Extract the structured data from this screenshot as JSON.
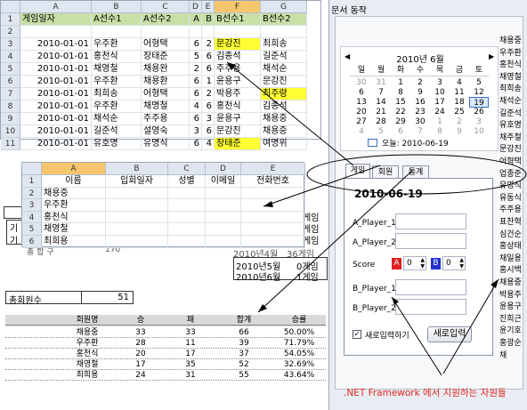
{
  "top_sheet": {
    "columns": [
      "A",
      "B",
      "C",
      "D",
      "E",
      "F",
      "G"
    ],
    "row_numbers": [
      "1",
      "2",
      "3",
      "4",
      "5",
      "6",
      "7",
      "8",
      "9",
      "10",
      "11"
    ],
    "header": [
      "게임일자",
      "A선수1",
      "A선수2",
      "A",
      "B",
      "B선수1",
      "B선수2"
    ],
    "rows": [
      [
        "",
        "",
        "",
        "",
        "",
        "",
        ""
      ],
      [
        "2010-01-01",
        "우주환",
        "어형택",
        "6",
        "2",
        "문강진",
        "최희송"
      ],
      [
        "2010-01-01",
        "홍천식",
        "장태준",
        "5",
        "6",
        "김종석",
        "길준석"
      ],
      [
        "2010-01-01",
        "채영철",
        "채용완",
        "2",
        "6",
        "주주용",
        "채석순"
      ],
      [
        "2010-01-01",
        "우주환",
        "채용환",
        "6",
        "1",
        "윤용구",
        "문강진"
      ],
      [
        "2010-01-01",
        "최희송",
        "어형택",
        "6",
        "2",
        "박용주",
        "최주령"
      ],
      [
        "2010-01-01",
        "우주환",
        "채명철",
        "4",
        "6",
        "홍천식",
        "김종석"
      ],
      [
        "2010-01-01",
        "채석순",
        "주주용",
        "6",
        "3",
        "윤용구",
        "채용중"
      ],
      [
        "2010-01-01",
        "길준석",
        "설영숙",
        "3",
        "6",
        "문강진",
        "채용중"
      ],
      [
        "2010-01-01",
        "유호명",
        "유명식",
        "6",
        "4",
        "장태준",
        "여명위"
      ]
    ]
  },
  "mid_sheet": {
    "columns": [
      "A",
      "B",
      "C",
      "D",
      "E"
    ],
    "row_numbers": [
      "1",
      "2",
      "3",
      "4",
      "5",
      "6"
    ],
    "header": [
      "이름",
      "입회일자",
      "성별",
      "이메일",
      "전화번호"
    ],
    "names": [
      "채용중",
      "우주환",
      "홍천식",
      "채영철",
      "최희용"
    ]
  },
  "back_fragments": {
    "left_labels": [
      "기",
      "기"
    ],
    "right_labels": [
      "게임",
      "게임",
      "게임",
      "게임"
    ],
    "total_row_left": "총 합 구",
    "total_row_num": "170",
    "partial_row": "2010년4월",
    "partial_count": "36게임",
    "month_rows": [
      {
        "month": "2010년5월",
        "count": "0게임"
      },
      {
        "month": "2010년6월",
        "count": "1게임"
      }
    ]
  },
  "member_total": {
    "label": "총회원수",
    "value": "51"
  },
  "stats_table": {
    "headers": [
      "회원명",
      "승",
      "패",
      "합계",
      "승률"
    ],
    "rows": [
      [
        "채용중",
        "33",
        "33",
        "66",
        "50.00%"
      ],
      [
        "우주환",
        "28",
        "11",
        "39",
        "71.79%"
      ],
      [
        "홍천식",
        "20",
        "17",
        "37",
        "54.05%"
      ],
      [
        "채영철",
        "17",
        "35",
        "52",
        "32.69%"
      ],
      [
        "최희용",
        "24",
        "31",
        "55",
        "43.64%"
      ]
    ]
  },
  "dialog": {
    "title": "문서 동작",
    "calendar": {
      "month_label": "2010년 6월",
      "weekdays": [
        "일",
        "월",
        "화",
        "수",
        "목",
        "금",
        "토"
      ],
      "weeks": [
        [
          "30",
          "31",
          "1",
          "2",
          "3",
          "4",
          "5"
        ],
        [
          "6",
          "7",
          "8",
          "9",
          "10",
          "11",
          "12"
        ],
        [
          "13",
          "14",
          "15",
          "16",
          "17",
          "18",
          "19"
        ],
        [
          "20",
          "21",
          "22",
          "23",
          "24",
          "25",
          "26"
        ],
        [
          "27",
          "28",
          "29",
          "30",
          "1",
          "2",
          "3"
        ],
        [
          "4",
          "5",
          "6",
          "7",
          "8",
          "9",
          "10"
        ]
      ],
      "today_label": "오늘: 2010-06-19"
    },
    "tabs": [
      "게임",
      "회원",
      "통계"
    ],
    "date_value": "2010-06-19",
    "a_player_1": "A_Player_1",
    "a_player_2": "A_Player_2",
    "score_label": "Score",
    "score_a_badge": "A",
    "score_a_value": "0",
    "score_b_badge": "B",
    "score_b_value": "0",
    "b_player_1": "B_Player_1",
    "b_player_2": "B_Player_2",
    "checkbox_label": "새로입력하기",
    "submit_label": "새로입력",
    "name_list": [
      "채용중",
      "우주환",
      "홍천식",
      "채영철",
      "최희송",
      "채석순",
      "길준석",
      "유호명",
      "채주철",
      "문강진",
      "어형택",
      "업종준",
      "유영식",
      "유동식",
      "주주용",
      "표찬혁",
      "심건순",
      "홍상태",
      "채일용",
      "홍시백",
      "채용중",
      "박용주",
      "윤용구",
      "진희근",
      "윤기호",
      "홍광순",
      "채"
    ]
  },
  "caption": ".NET Framework 에서 지원하는 자원들",
  "colors": {
    "highlight": "#ffff33",
    "header_green": "#c8e0a8",
    "caption_red": "#e0281e"
  }
}
